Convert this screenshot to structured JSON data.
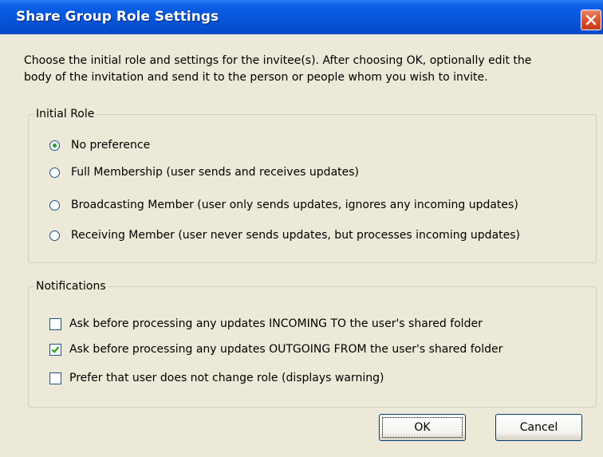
{
  "window": {
    "title": "Share Group Role Settings",
    "close_icon": "close-icon"
  },
  "intro_text_line1": "Choose the initial role and settings for the invitee(s).  After choosing OK, optionally edit the",
  "intro_text_line2": "body of the invitation and send it to the person or people whom you wish to invite.",
  "initial_role": {
    "legend": "Initial Role",
    "options": [
      {
        "label": "No preference",
        "checked": true
      },
      {
        "label": "Full Membership (user sends and receives updates)",
        "checked": false
      },
      {
        "label": "Broadcasting Member (user only sends updates, ignores any incoming updates)",
        "checked": false
      },
      {
        "label": "Receiving Member (user never sends updates, but processes incoming updates)",
        "checked": false
      }
    ]
  },
  "notifications": {
    "legend": "Notifications",
    "options": [
      {
        "label": "Ask before processing any updates INCOMING TO the user's shared folder",
        "checked": false
      },
      {
        "label": "Ask before processing any updates OUTGOING FROM the user's shared folder",
        "checked": true
      },
      {
        "label": "Prefer that user does not change role (displays warning)",
        "checked": false
      }
    ]
  },
  "buttons": {
    "ok": "OK",
    "cancel": "Cancel"
  },
  "colors": {
    "titlebar": "#0654D8",
    "dialog_bg": "#ECE9D8",
    "radio_dot": "#21A121",
    "check_mark": "#21A121"
  }
}
